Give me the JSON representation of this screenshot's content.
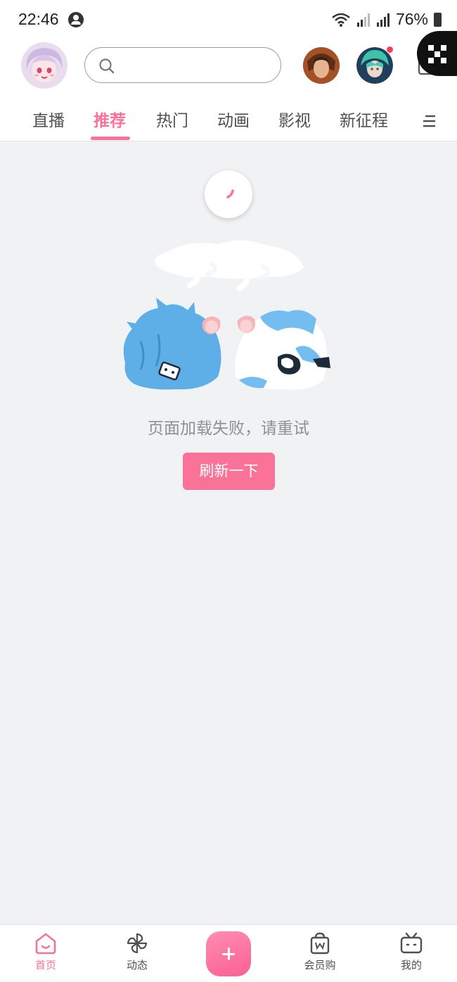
{
  "status_bar": {
    "time": "22:46",
    "battery": "76%",
    "icons": [
      "account-circle-icon",
      "wifi-icon",
      "signal-icon",
      "signal-icon",
      "battery-icon"
    ]
  },
  "header": {
    "avatar": "user-avatar",
    "search": {
      "placeholder": "",
      "icon": "search-icon"
    },
    "game_icons": [
      "game-avatar-1",
      "game-avatar-2"
    ],
    "has_notification": true,
    "message_icon": "mail-icon",
    "floating_icon": "qr-code-icon"
  },
  "tabs": [
    {
      "label": "直播",
      "active": false
    },
    {
      "label": "推荐",
      "active": true
    },
    {
      "label": "热门",
      "active": false
    },
    {
      "label": "动画",
      "active": false
    },
    {
      "label": "影视",
      "active": false
    },
    {
      "label": "新征程",
      "active": false
    }
  ],
  "tab_menu_icon": "menu-icon",
  "content": {
    "error_message": "页面加载失败，请重试",
    "retry_label": "刷新一下",
    "illustration": "tired-mascots-illustration",
    "loading_icon": "loading-spinner-icon"
  },
  "bottom_nav": [
    {
      "label": "首页",
      "icon": "home-icon",
      "active": true
    },
    {
      "label": "动态",
      "icon": "pinwheel-icon",
      "active": false
    },
    {
      "label": "",
      "icon": "plus-icon",
      "active": false
    },
    {
      "label": "会员购",
      "icon": "shopping-bag-icon",
      "active": false
    },
    {
      "label": "我的",
      "icon": "tv-icon",
      "active": false
    }
  ],
  "colors": {
    "accent": "#fb7299",
    "background": "#f1f2f4",
    "text": "#505050",
    "muted": "#8d9095"
  }
}
